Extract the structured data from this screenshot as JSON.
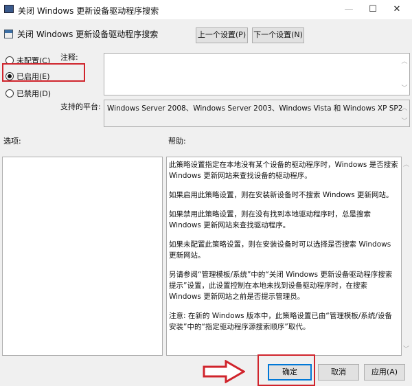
{
  "window": {
    "title": "关闭 Windows 更新设备驱动程序搜索",
    "minimize": "—",
    "maximize": "☐",
    "close": "✕"
  },
  "header": {
    "policy_name": "关闭 Windows 更新设备驱动程序搜索",
    "prev_button": "上一个设置(P)",
    "next_button": "下一个设置(N)"
  },
  "state": {
    "options": [
      {
        "label": "未配置(C)",
        "selected": false
      },
      {
        "label": "已启用(E)",
        "selected": true
      },
      {
        "label": "已禁用(D)",
        "selected": false
      }
    ]
  },
  "comment": {
    "label": "注释:",
    "value": ""
  },
  "platform": {
    "label": "支持的平台:",
    "value": "Windows Server 2008、Windows Server 2003、Windows Vista 和 Windows XP SP2"
  },
  "options_label": "选项:",
  "help": {
    "label": "帮助:",
    "paragraphs": [
      "此策略设置指定在本地没有某个设备的驱动程序时，Windows 是否搜索 Windows 更新网站来查找设备的驱动程序。",
      "如果启用此策略设置，则在安装新设备时不搜索 Windows 更新网站。",
      "如果禁用此策略设置，则在没有找到本地驱动程序时，总是搜索 Windows 更新网站来查找驱动程序。",
      "如果未配置此策略设置，则在安装设备时可以选择是否搜索 Windows 更新网站。",
      "另请参阅“管理模板/系统”中的“关闭 Windows 更新设备驱动程序搜索提示”设置，此设置控制在本地未找到设备驱动程序时，在搜索 Windows 更新网站之前是否提示管理员。",
      "注意: 在新的 Windows 版本中，此策略设置已由“管理模板/系统/设备安装”中的“指定驱动程序源搜索顺序”取代。"
    ]
  },
  "footer": {
    "ok": "确定",
    "cancel": "取消",
    "apply": "应用(A)"
  },
  "colors": {
    "highlight": "#d0242c"
  }
}
